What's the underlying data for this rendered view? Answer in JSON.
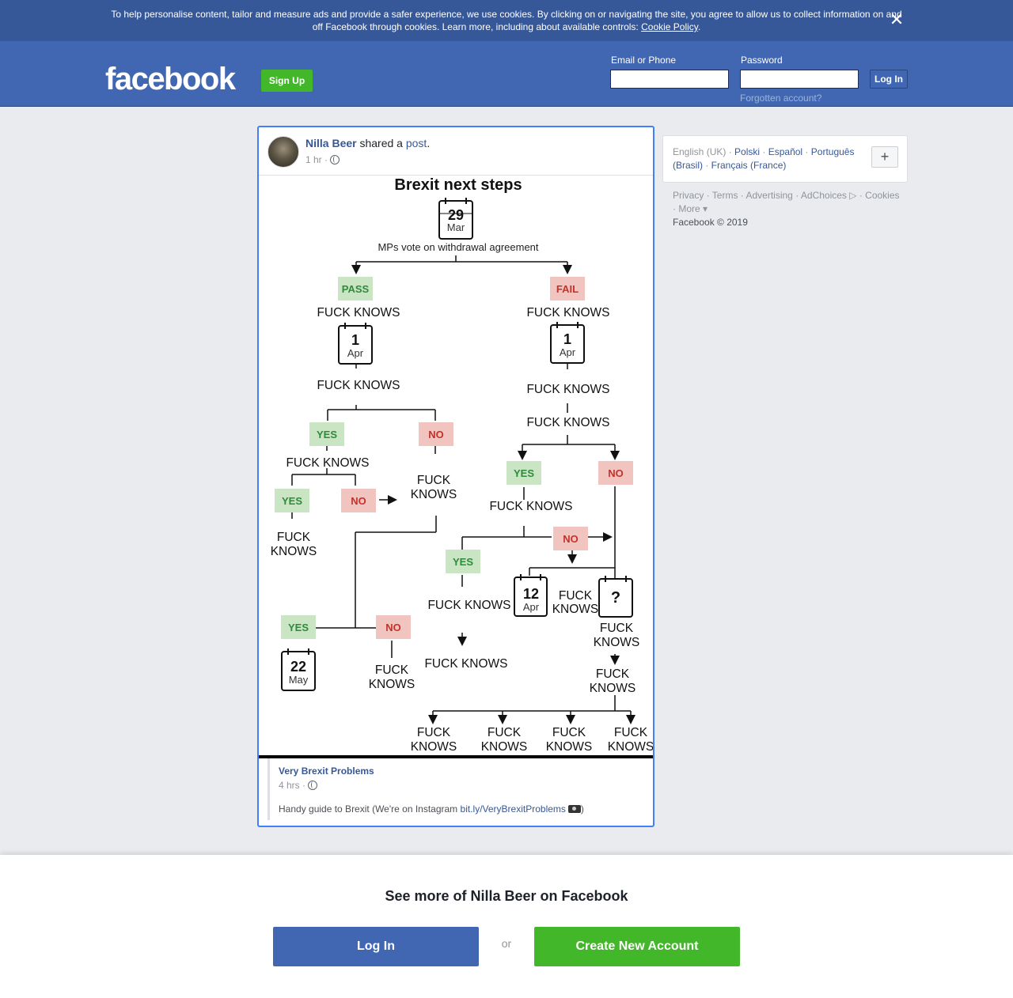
{
  "cookie_banner": {
    "text": "To help personalise content, tailor and measure ads and provide a safer experience, we use cookies. By clicking on or navigating the site, you agree to allow us to collect information on and off Facebook through cookies. Learn more, including about available controls:",
    "link": "Cookie Policy",
    "link_suffix": ".",
    "close_icon": "close-icon"
  },
  "header": {
    "logo": "facebook",
    "signup": "Sign Up",
    "email_label": "Email or Phone",
    "password_label": "Password",
    "login": "Log In",
    "forgot": "Forgotten account?"
  },
  "post": {
    "author": "Nilla Beer",
    "action": "shared a",
    "link": "post",
    "link_suffix": ".",
    "time": "1 hr ·",
    "shared": {
      "page_name": "Very Brexit Problems",
      "time": "4 hrs ·",
      "caption": "Handy guide to Brexit (We're on Instagram",
      "caption_link": "bit.ly/VeryBrexitProblems",
      "caption_end": ")"
    }
  },
  "flowchart": {
    "title": "Brexit next steps",
    "labels": {
      "fk": "FUCK KNOWS",
      "fuck": "FUCK",
      "knows": "KNOWS",
      "pass": "PASS",
      "fail": "FAIL",
      "yes": "YES",
      "no": "NO",
      "vote": "MPs vote on withdrawal agreement",
      "question": "?"
    },
    "calendars": {
      "c29": {
        "day": "29",
        "month": "Mar"
      },
      "c1a": {
        "day": "1",
        "month": "Apr"
      },
      "c1b": {
        "day": "1",
        "month": "Apr"
      },
      "c12": {
        "day": "12",
        "month": "Apr"
      },
      "c22": {
        "day": "22",
        "month": "May"
      }
    },
    "colors": {
      "yes_bg": "#c9e5c4",
      "yes_fg": "#2f8a3a",
      "no_bg": "#f2c4c0",
      "no_fg": "#c2322b"
    }
  },
  "sidebar": {
    "languages": {
      "current": "English (UK)",
      "l1": "Polski",
      "l2": "Español",
      "l3": "Português (Brasil)",
      "l4": "Français (France)"
    },
    "plus": "+",
    "links": {
      "privacy": "Privacy",
      "terms": "Terms",
      "advertising": "Advertising",
      "adchoices": "AdChoices",
      "cookies": "Cookies",
      "more": "More",
      "copyright": "Facebook © 2019"
    }
  },
  "bottom": {
    "heading": "See more of Nilla Beer on Facebook",
    "login": "Log In",
    "or": "or",
    "create": "Create New Account"
  }
}
